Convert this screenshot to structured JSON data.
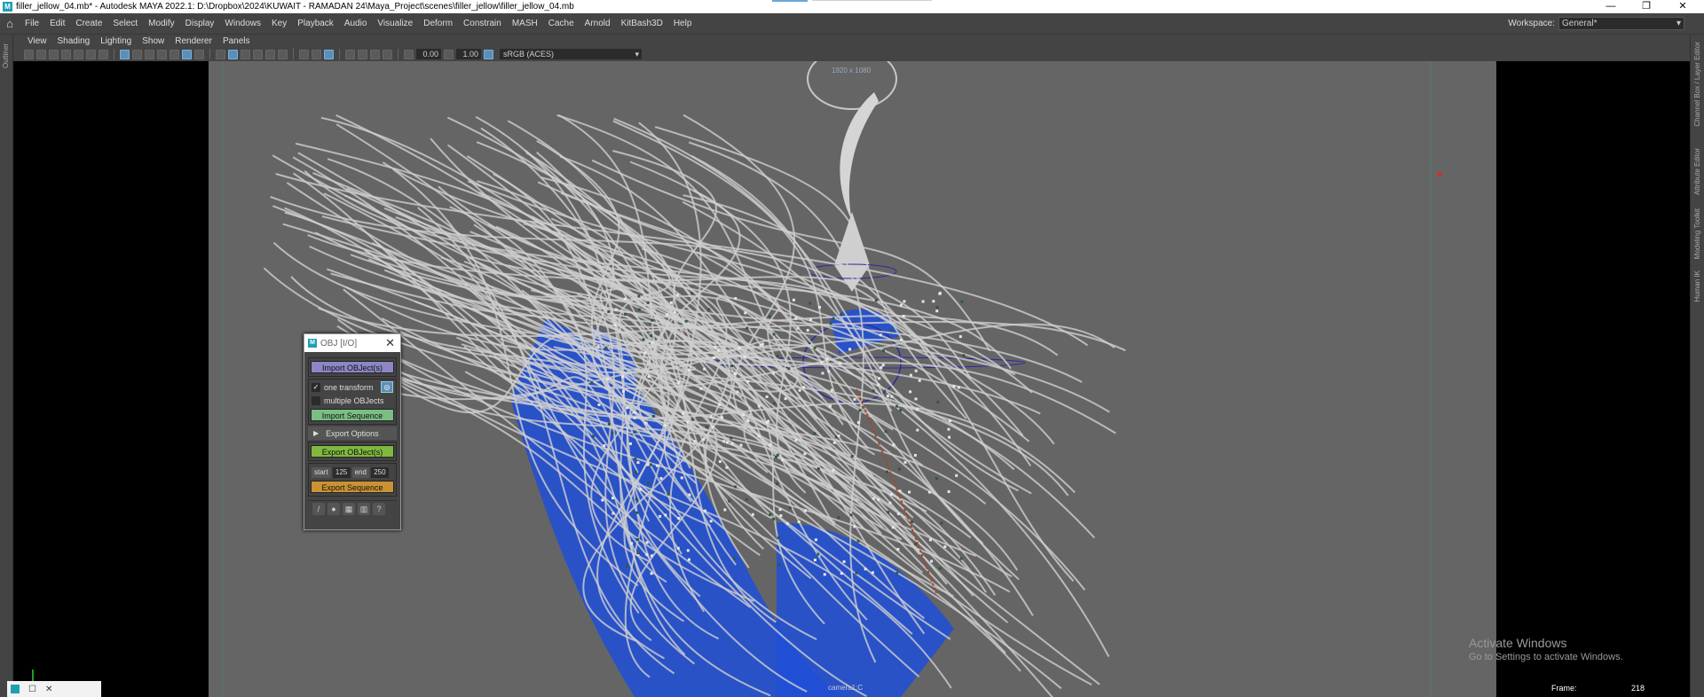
{
  "window": {
    "title": "filler_jellow_04.mb* - Autodesk MAYA 2022.1: D:\\Dropbox\\2024\\KUWAIT - RAMADAN 24\\Maya_Project\\scenes\\filler_jellow\\filler_jellow_04.mb",
    "controls": {
      "minimize": "—",
      "restore": "❐",
      "close": "✕"
    }
  },
  "menubar": {
    "items": [
      "File",
      "Edit",
      "Create",
      "Select",
      "Modify",
      "Display",
      "Windows",
      "Key",
      "Playback",
      "Audio",
      "Visualize",
      "Deform",
      "Constrain",
      "MASH",
      "Cache",
      "Arnold",
      "KitBash3D",
      "Help"
    ],
    "workspace_label": "Workspace:",
    "workspace_value": "General*"
  },
  "left_strip": {
    "label": "Outliner"
  },
  "right_strip": {
    "labels": [
      "Channel Box / Layer Editor",
      "Attribute Editor",
      "Modeling Toolkit",
      "Human IK"
    ]
  },
  "panel_menu": {
    "items": [
      "View",
      "Shading",
      "Lighting",
      "Show",
      "Renderer",
      "Panels"
    ]
  },
  "panel_toolbar": {
    "exposure": "0.00",
    "gamma": "1.00",
    "color_space": "sRGB (ACES)"
  },
  "viewport": {
    "resolution_label": "1920 x 1080",
    "camera_label": "camera1:C",
    "frame_label": "Frame:",
    "frame_value": "218",
    "watermark_title": "Activate Windows",
    "watermark_sub": "Go to Settings to activate Windows."
  },
  "obj_window": {
    "title": "OBJ [I/O]",
    "import_objects": "Import OBJect(s)",
    "one_transform": "one transform",
    "multiple_objects": "multiple OBJects",
    "import_sequence": "Import Sequence",
    "export_options": "Export Options",
    "export_objects": "Export OBJect(s)",
    "start_label": "start",
    "start_value": "125",
    "end_label": "end",
    "end_value": "250",
    "export_sequence": "Export Sequence"
  },
  "colors": {
    "viewport_gate": "#656565",
    "btn_purple": "#8c86c6",
    "btn_green": "#7bbe84",
    "btn_lime": "#7fb93f",
    "btn_orange": "#c99333",
    "mesh_blue": "#1f4fd8"
  }
}
